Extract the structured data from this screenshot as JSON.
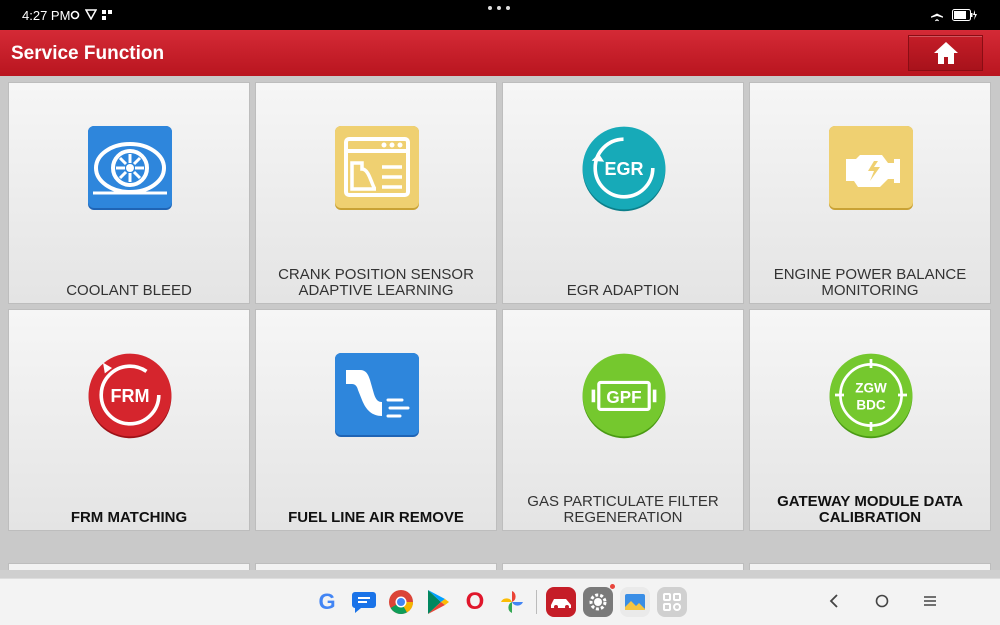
{
  "status_bar": {
    "time": "4:27 PM"
  },
  "header": {
    "title": "Service Function"
  },
  "tiles": [
    {
      "label_line1": "",
      "label_line2": "COOLANT BLEED"
    },
    {
      "label_line1": "CRANK POSITION SENSOR",
      "label_line2": "ADAPTIVE LEARNING"
    },
    {
      "label_line1": "",
      "label_line2": "EGR ADAPTION",
      "icon_text": "EGR"
    },
    {
      "label_line1": "ENGINE POWER BALANCE",
      "label_line2": "MONITORING"
    },
    {
      "label_line1": "",
      "label_line2": "FRM MATCHING",
      "icon_text": "FRM"
    },
    {
      "label_line1": "",
      "label_line2": "FUEL LINE AIR REMOVE"
    },
    {
      "label_line1": "GAS PARTICULATE FILTER",
      "label_line2": "REGENERATION",
      "icon_text": "GPF"
    },
    {
      "label_line1": "GATEWAY MODULE DATA",
      "label_line2": "CALIBRATION",
      "icon_text_1": "ZGW",
      "icon_text_2": "BDC"
    }
  ],
  "icons": {
    "coolant": "fan-icon",
    "crank": "sensor-chart-icon",
    "egr": "egr-icon",
    "engine": "engine-icon",
    "frm": "frm-icon",
    "fuel": "fuel-pipe-icon",
    "gpf": "gpf-icon",
    "gateway": "zgw-bdc-icon"
  },
  "colors": {
    "header_red": "#c41d28",
    "blue": "#2e7fd6",
    "gold": "#e8c75a",
    "teal": "#1aa7b5",
    "red": "#cc2026",
    "green": "#6cc42a"
  },
  "dock_apps": [
    "Google",
    "Messages",
    "Chrome",
    "Play Store",
    "Opera",
    "Photos",
    "Diagnostic",
    "Settings",
    "Gallery",
    "App Library"
  ],
  "google_letter": "G",
  "opera_letter": "O"
}
